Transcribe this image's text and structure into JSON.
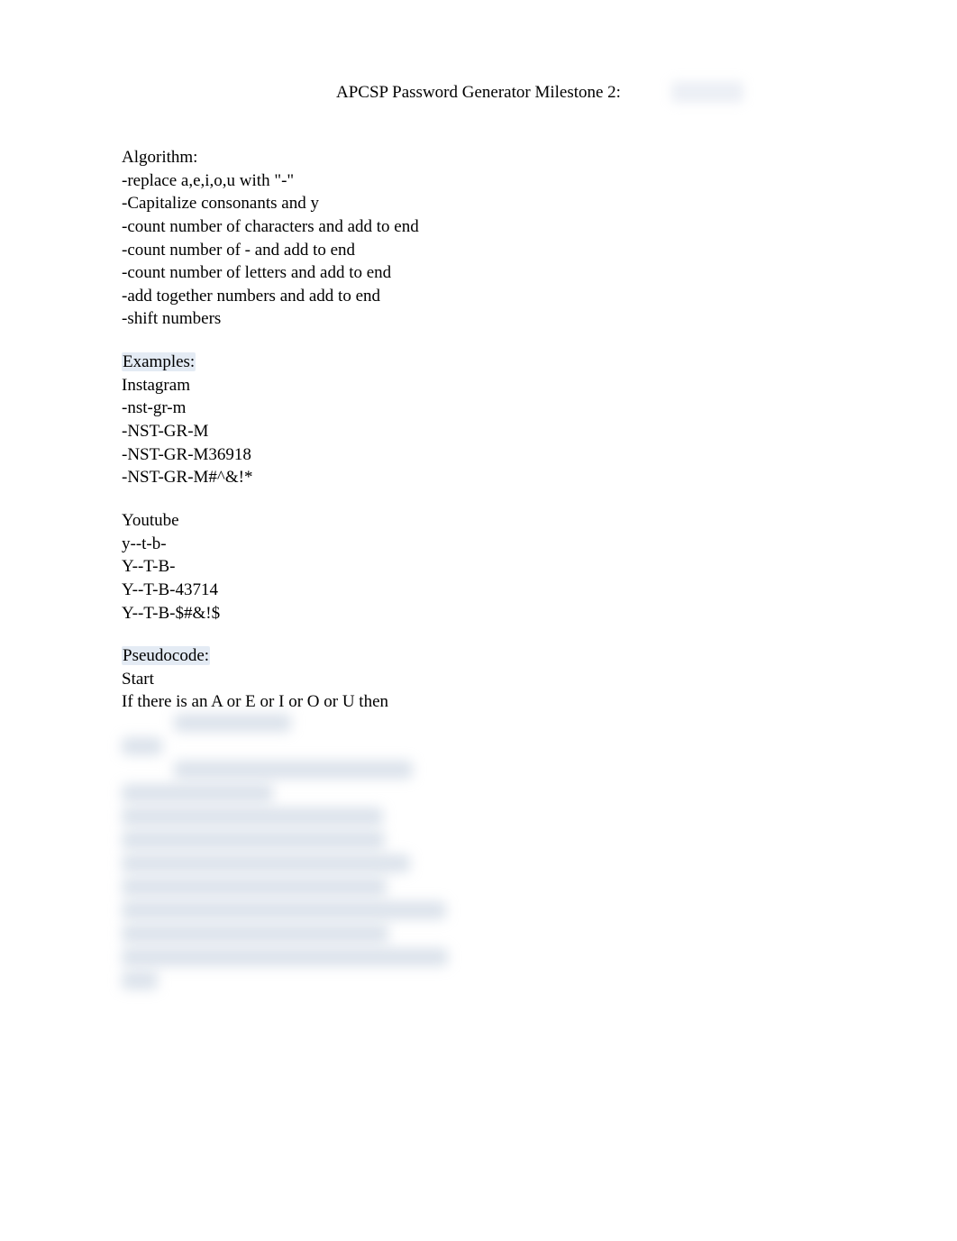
{
  "title": "APCSP Password Generator Milestone 2:",
  "algorithm": {
    "heading": "Algorithm:",
    "lines": [
      "-replace a,e,i,o,u with \"-\"",
      "-Capitalize consonants and y",
      "-count number of characters and add to end",
      "-count number of - and add to end",
      "-count number of letters and add to end",
      "-add together numbers and add to end",
      "-shift numbers"
    ]
  },
  "examples": {
    "heading": "Examples:",
    "groups": [
      {
        "name": "Instagram",
        "lines": [
          "-nst-gr-m",
          "-NST-GR-M",
          "-NST-GR-M36918",
          "-NST-GR-M#^&!*"
        ]
      },
      {
        "name": "Youtube",
        "lines": [
          "y--t-b-",
          "Y--T-B-",
          "Y--T-B-43714",
          "Y--T-B-$#&!$"
        ]
      }
    ]
  },
  "pseudocode": {
    "heading": "Pseudocode:",
    "lines": [
      "Start",
      "If there is an A or E or I or O or U then"
    ]
  }
}
